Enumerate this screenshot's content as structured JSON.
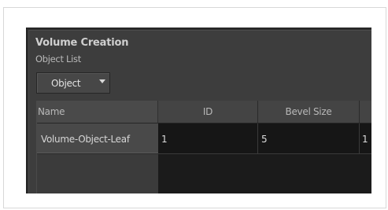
{
  "panel": {
    "title": "Volume Creation",
    "subtitle": "Object List",
    "dropdown": {
      "selected": "Object",
      "icon": "triangle-down-icon"
    }
  },
  "table": {
    "columns": [
      "Name",
      "ID",
      "Bevel Size",
      ""
    ],
    "rows": [
      {
        "name": "Volume-Object-Leaf",
        "id": "1",
        "bevel_size": "5",
        "extra": "1"
      }
    ]
  },
  "colors": {
    "panel_bg": "#3d3d3d",
    "table_bg": "#1b1b1b",
    "header_bg": "#444444",
    "text": "#dcdcdc"
  }
}
